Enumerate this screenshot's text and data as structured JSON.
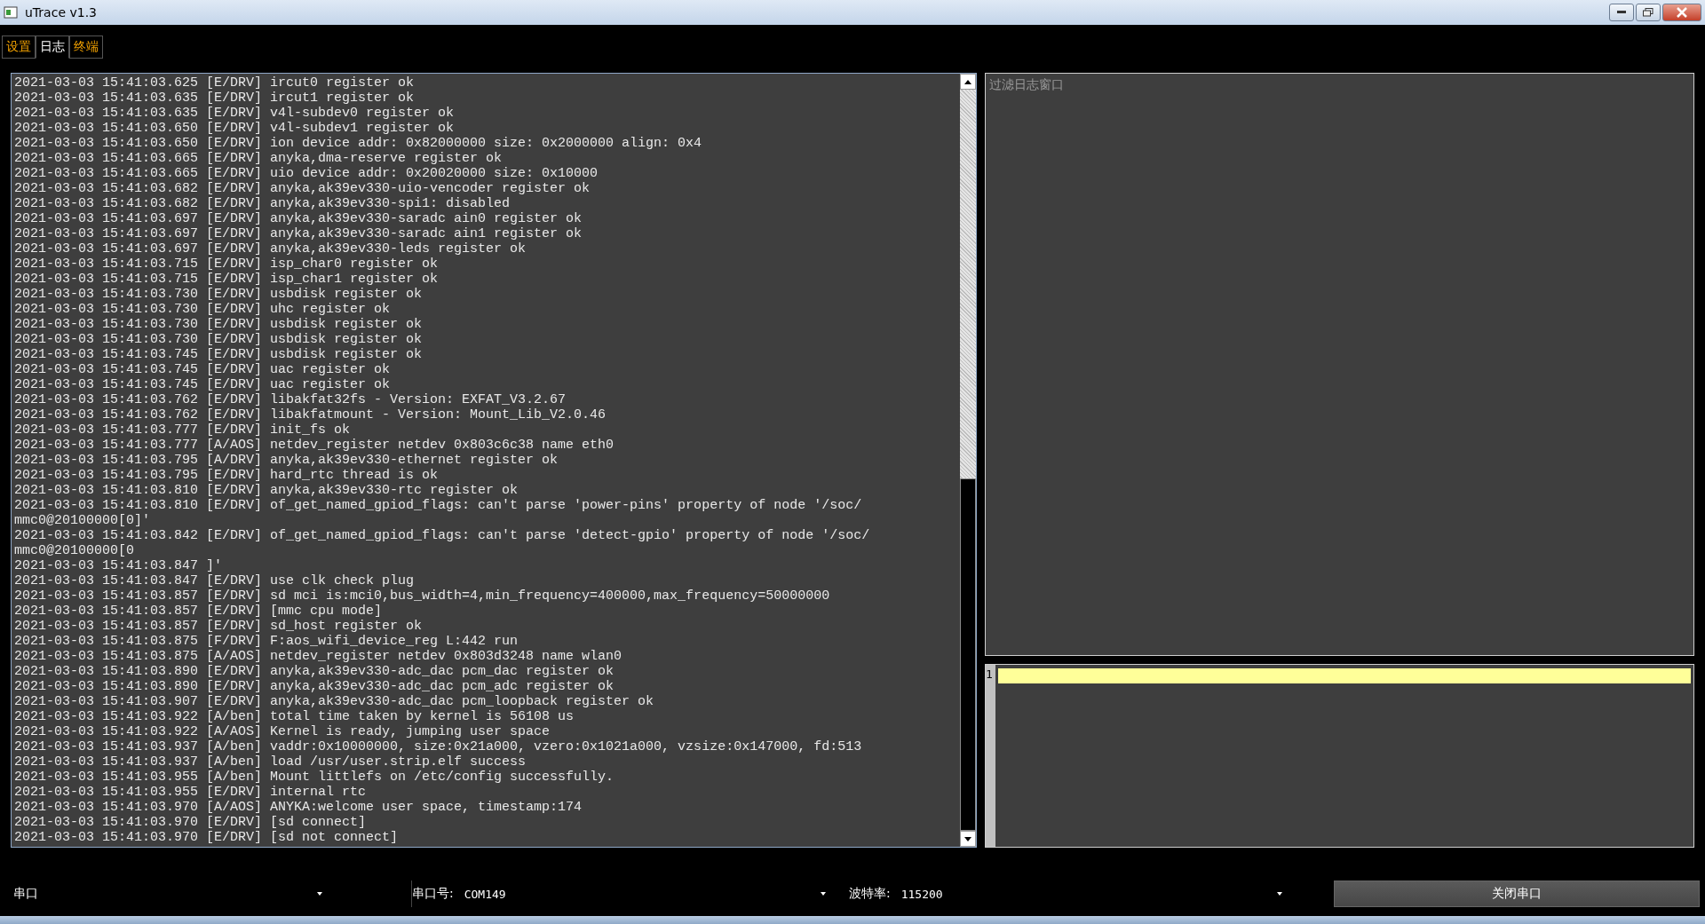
{
  "window": {
    "title": "uTrace v1.3"
  },
  "tabs": [
    {
      "label": "设置",
      "selected": false
    },
    {
      "label": "日志",
      "selected": true
    },
    {
      "label": "终端",
      "selected": false
    }
  ],
  "log": {
    "lines": [
      "2021-03-03 15:41:03.625 [E/DRV] ircut0 register ok",
      "2021-03-03 15:41:03.635 [E/DRV] ircut1 register ok",
      "2021-03-03 15:41:03.635 [E/DRV] v4l-subdev0 register ok",
      "2021-03-03 15:41:03.650 [E/DRV] v4l-subdev1 register ok",
      "2021-03-03 15:41:03.650 [E/DRV] ion device addr: 0x82000000 size: 0x2000000 align: 0x4",
      "2021-03-03 15:41:03.665 [E/DRV] anyka,dma-reserve register ok",
      "2021-03-03 15:41:03.665 [E/DRV] uio device addr: 0x20020000 size: 0x10000",
      "2021-03-03 15:41:03.682 [E/DRV] anyka,ak39ev330-uio-vencoder register ok",
      "2021-03-03 15:41:03.682 [E/DRV] anyka,ak39ev330-spi1: disabled",
      "2021-03-03 15:41:03.697 [E/DRV] anyka,ak39ev330-saradc ain0 register ok",
      "2021-03-03 15:41:03.697 [E/DRV] anyka,ak39ev330-saradc ain1 register ok",
      "2021-03-03 15:41:03.697 [E/DRV] anyka,ak39ev330-leds register ok",
      "2021-03-03 15:41:03.715 [E/DRV] isp_char0 register ok",
      "2021-03-03 15:41:03.715 [E/DRV] isp_char1 register ok",
      "2021-03-03 15:41:03.730 [E/DRV] usbdisk register ok",
      "2021-03-03 15:41:03.730 [E/DRV] uhc register ok",
      "2021-03-03 15:41:03.730 [E/DRV] usbdisk register ok",
      "2021-03-03 15:41:03.730 [E/DRV] usbdisk register ok",
      "2021-03-03 15:41:03.745 [E/DRV] usbdisk register ok",
      "2021-03-03 15:41:03.745 [E/DRV] uac register ok",
      "2021-03-03 15:41:03.745 [E/DRV] uac register ok",
      "2021-03-03 15:41:03.762 [E/DRV] libakfat32fs - Version: EXFAT_V3.2.67",
      "2021-03-03 15:41:03.762 [E/DRV] libakfatmount - Version: Mount_Lib_V2.0.46",
      "2021-03-03 15:41:03.777 [E/DRV] init_fs ok",
      "2021-03-03 15:41:03.777 [A/AOS] netdev_register netdev 0x803c6c38 name eth0",
      "2021-03-03 15:41:03.795 [A/DRV] anyka,ak39ev330-ethernet register ok",
      "2021-03-03 15:41:03.795 [E/DRV] hard_rtc thread is ok",
      "2021-03-03 15:41:03.810 [E/DRV] anyka,ak39ev330-rtc register ok",
      "2021-03-03 15:41:03.810 [E/DRV] of_get_named_gpiod_flags: can't parse 'power-pins' property of node '/soc/",
      "mmc0@20100000[0]'",
      "2021-03-03 15:41:03.842 [E/DRV] of_get_named_gpiod_flags: can't parse 'detect-gpio' property of node '/soc/",
      "mmc0@20100000[0",
      "2021-03-03 15:41:03.847 ]'",
      "2021-03-03 15:41:03.847 [E/DRV] use clk check plug",
      "2021-03-03 15:41:03.857 [E/DRV] sd mci is:mci0,bus_width=4,min_frequency=400000,max_frequency=50000000",
      "2021-03-03 15:41:03.857 [E/DRV] [mmc cpu mode]",
      "2021-03-03 15:41:03.857 [E/DRV] sd_host register ok",
      "2021-03-03 15:41:03.875 [F/DRV] F:aos_wifi_device_reg L:442 run",
      "2021-03-03 15:41:03.875 [A/AOS] netdev_register netdev 0x803d3248 name wlan0",
      "2021-03-03 15:41:03.890 [E/DRV] anyka,ak39ev330-adc_dac pcm_dac register ok",
      "2021-03-03 15:41:03.890 [E/DRV] anyka,ak39ev330-adc_dac pcm_adc register ok",
      "2021-03-03 15:41:03.907 [E/DRV] anyka,ak39ev330-adc_dac pcm_loopback register ok",
      "2021-03-03 15:41:03.922 [A/ben] total time taken by kernel is 56108 us",
      "2021-03-03 15:41:03.922 [A/AOS] Kernel is ready, jumping user space",
      "2021-03-03 15:41:03.937 [A/ben] vaddr:0x10000000, size:0x21a000, vzero:0x1021a000, vzsize:0x147000, fd:513",
      "2021-03-03 15:41:03.937 [A/ben] load /usr/user.strip.elf success",
      "2021-03-03 15:41:03.955 [A/ben] Mount littlefs on /etc/config successfully.",
      "2021-03-03 15:41:03.955 [E/DRV] internal rtc",
      "2021-03-03 15:41:03.970 [A/AOS] ANYKA:welcome user space, timestamp:174",
      "2021-03-03 15:41:03.970 [E/DRV] [sd connect]",
      "2021-03-03 15:41:03.970 [E/DRV] [sd not connect]"
    ]
  },
  "filter": {
    "placeholder": "过滤日志窗口"
  },
  "editor": {
    "line_number": "1"
  },
  "bottom_bar": {
    "mode": "串口",
    "port_label": "串口号:",
    "port": "COM149",
    "baud_label": "波特率:",
    "baud": "115200",
    "button": "关闭串口"
  }
}
